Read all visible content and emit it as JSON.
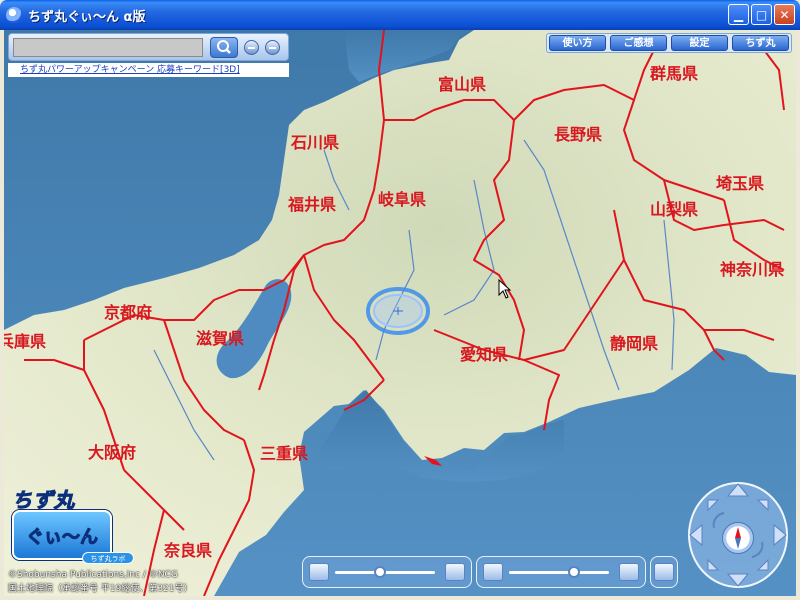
{
  "window": {
    "title": "ちず丸ぐぃ〜ん α版",
    "controls": {
      "minimize_icon": "minimize-icon",
      "maximize_icon": "maximize-icon",
      "close_icon": "close-icon"
    }
  },
  "search": {
    "value": "",
    "search_icon": "magnifier-icon",
    "zoom_out_icon": "minus-icon",
    "zoom_out2_icon": "minus-icon"
  },
  "promo": {
    "text": "ちず丸パワーアップキャンペーン 応募キーワード[3D]"
  },
  "menu": {
    "items": [
      {
        "label": "使い方"
      },
      {
        "label": "ご感想"
      },
      {
        "label": "設定"
      },
      {
        "label": "ちず丸"
      }
    ]
  },
  "map": {
    "prefectures": [
      {
        "name": "富山県"
      },
      {
        "name": "群馬県"
      },
      {
        "name": "石川県"
      },
      {
        "name": "長野県"
      },
      {
        "name": "福井県"
      },
      {
        "name": "岐阜県"
      },
      {
        "name": "埼玉県"
      },
      {
        "name": "山梨県"
      },
      {
        "name": "神奈川県"
      },
      {
        "name": "京都府"
      },
      {
        "name": "兵庫県"
      },
      {
        "name": "滋賀県"
      },
      {
        "name": "愛知県"
      },
      {
        "name": "静岡県"
      },
      {
        "name": "大阪府"
      },
      {
        "name": "三重県"
      },
      {
        "name": "奈良県"
      }
    ],
    "colors": {
      "sea": "#4b86b5",
      "land": "#dfe6c8",
      "border": "#e1141c",
      "river": "#5a87c9"
    }
  },
  "logo": {
    "text": "ちず丸",
    "badge_text": "ぐぃ〜ん",
    "sub_text": "ちず丸ラボ"
  },
  "credits": {
    "line1": "©Shobunsha Publications,Inc / ©NCG",
    "line2": "国土地理院（承認番号 平19総使、第321号）"
  },
  "controls": {
    "slider1": {
      "value_fraction": 0.45
    },
    "slider2": {
      "value_fraction": 0.65
    }
  }
}
